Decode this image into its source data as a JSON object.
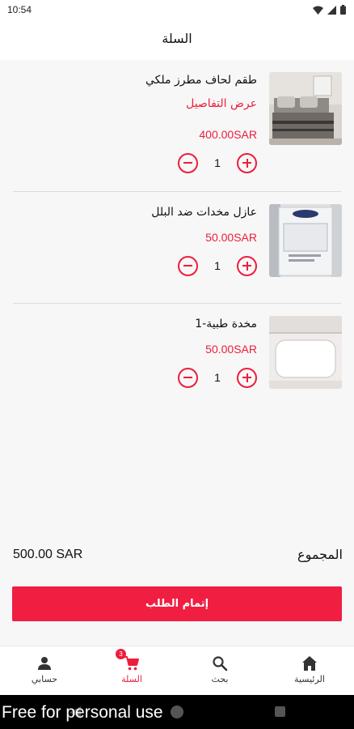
{
  "status_bar": {
    "time": "10:54"
  },
  "header": {
    "title": "السلة"
  },
  "cart": {
    "items": [
      {
        "name": "طقم لحاف مطرز ملكي",
        "details_link": "عرض التفاصيل",
        "price": "400.00SAR",
        "quantity": "1"
      },
      {
        "name": "عازل مخدات ضد البلل",
        "price": "50.00SAR",
        "quantity": "1"
      },
      {
        "name": "مخدة طبية-1",
        "price": "50.00SAR",
        "quantity": "1"
      }
    ]
  },
  "summary": {
    "total_label": "المجموع",
    "total_value": "500.00 SAR"
  },
  "checkout": {
    "label": "إتمام الطلب"
  },
  "bottom_nav": {
    "items": [
      {
        "label": "الرئيسية",
        "icon": "home-icon"
      },
      {
        "label": "بحث",
        "icon": "search-icon"
      },
      {
        "label": "السلة",
        "icon": "cart-icon",
        "active": true,
        "badge": "3"
      },
      {
        "label": "حسابي",
        "icon": "person-icon"
      }
    ]
  },
  "watermark": "Free for personal use",
  "colors": {
    "accent": "#ee1d3c",
    "checkout_button": "#f01f42",
    "background": "#f7f7f7"
  }
}
